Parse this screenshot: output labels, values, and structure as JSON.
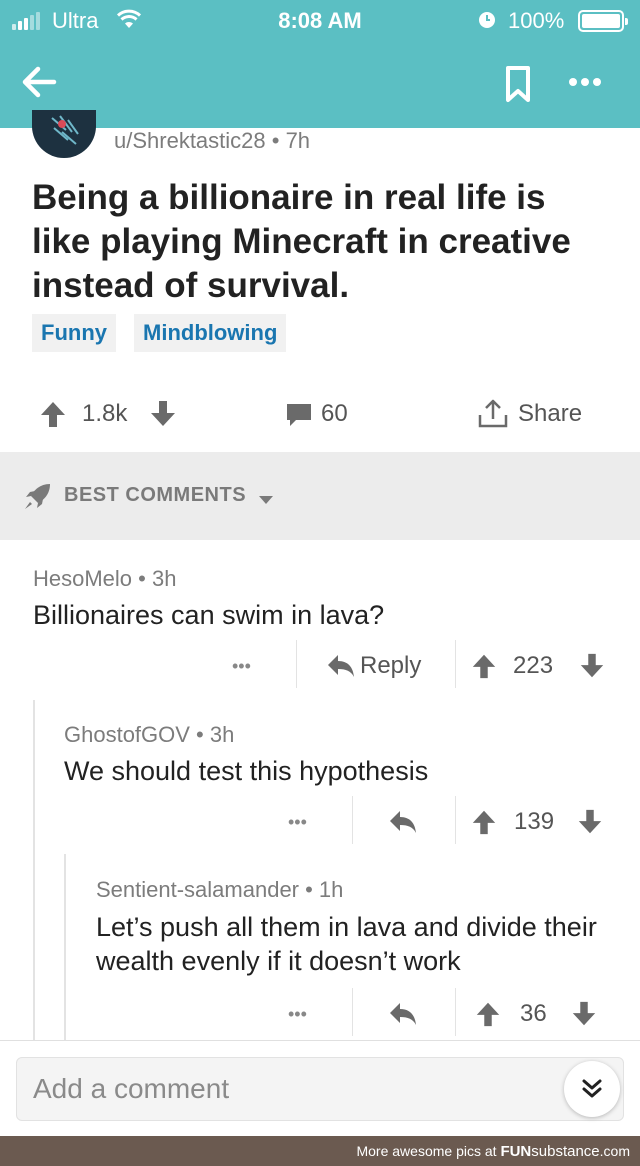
{
  "status": {
    "carrier": "Ultra",
    "time": "8:08 AM",
    "battery": "100%"
  },
  "post": {
    "meta": "u/Shrektastic28 • 7h",
    "title": "Being a billionaire in real life is like playing Minecraft in creative instead of survival.",
    "tags": [
      "Funny",
      "Mindblowing"
    ],
    "score": "1.8k",
    "comments": "60",
    "share_label": "Share"
  },
  "best_comments_label": "BEST COMMENTS",
  "comments": [
    {
      "meta": "HesoMelo • 3h",
      "body": "Billionaires can swim in lava?",
      "more": "•••",
      "reply_label": "Reply",
      "score": "223"
    },
    {
      "meta": "GhostofGOV • 3h",
      "body": "We should test this hypothesis",
      "more": "•••",
      "score": "139"
    },
    {
      "meta": "Sentient-salamander • 1h",
      "body": "Let’s push all them in lava and divide their wealth evenly if it doesn’t work",
      "more": "•••",
      "score": "36"
    }
  ],
  "add_comment_placeholder": "Add a comment",
  "footer": {
    "prefix": "More awesome pics at",
    "brand_a": "FUN",
    "brand_b": "substance",
    "brand_c": ".com"
  },
  "colors": {
    "header": "#5bbfc3",
    "tag_text": "#1a76b0",
    "footer": "#6b5a50"
  },
  "icons": [
    "back-arrow-icon",
    "bookmark-icon",
    "more-icon",
    "upvote-icon",
    "downvote-icon",
    "comment-icon",
    "share-icon",
    "rocket-icon",
    "reply-icon",
    "collapse-icon"
  ]
}
